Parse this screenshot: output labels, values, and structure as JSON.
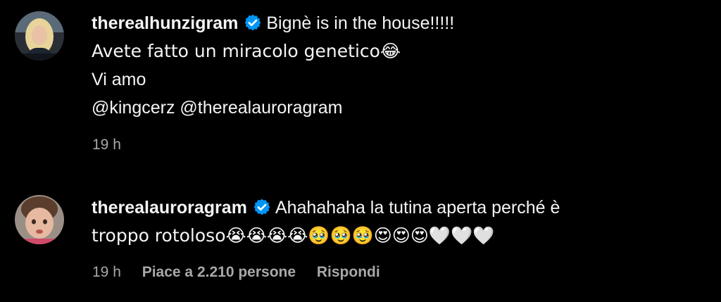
{
  "comments": [
    {
      "username": "therealhunzigram",
      "verified": true,
      "lines": [
        "Bignè is in the house!!!!!",
        "Avete fatto un miracolo genetico😂",
        "Vi amo",
        "@kingcerz @therealauroragram"
      ],
      "time": "19 h"
    },
    {
      "username": "therealauroragram",
      "verified": true,
      "lines": [
        "Ahahahaha la tutina aperta perché è",
        "troppo rotoloso😭😭😭😭🥹🥹🥹😍😍😍🤍🤍🤍"
      ],
      "time": "19 h",
      "likes": "Piace a 2.210 persone",
      "reply": "Rispondi"
    }
  ],
  "colors": {
    "background": "#000000",
    "text": "#f5f5f5",
    "meta": "#a8a8a8",
    "verified_badge": "#0095f6"
  }
}
